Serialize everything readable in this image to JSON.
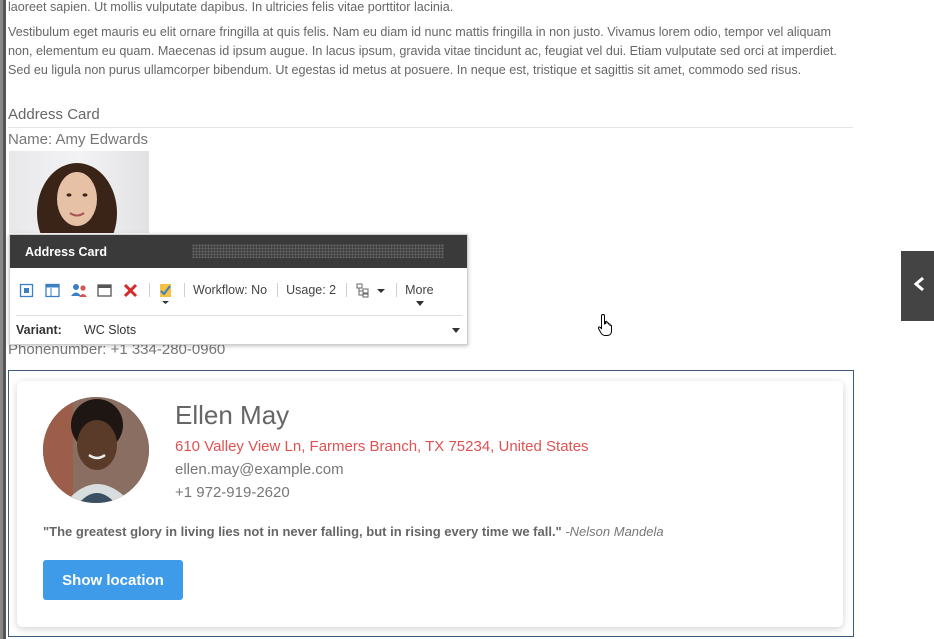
{
  "text": {
    "para1": "laoreet sapien. Ut mollis vulputate dapibus. In ultricies felis vitae porttitor lacinia.",
    "para2": "Vestibulum eget mauris eu elit ornare fringilla at quis felis. Nam eu diam id nunc mattis fringilla in non justo. Vivamus lorem odio, tempor vel aliquam non, elementum eu quam. Maecenas id ipsum augue. In lacus ipsum, gravida vitae tincidunt ac, feugiat vel dui. Etiam vulputate sed orci at imperdiet. Sed eu ligula non purus ullamcorper bibendum. Ut egestas id metus at posuere. In neque est, tristique et sagittis sit amet, commodo sed risus.",
    "heading": "Address Card",
    "name_line": "Name: Amy Edwards",
    "phone_line": "Phonenumber: +1 334-280-0960"
  },
  "toolbar": {
    "title": "Address Card",
    "workflow": "Workflow: No",
    "usage": "Usage: 2",
    "more": "More",
    "variant_label": "Variant:",
    "variant_value": "WC Slots",
    "icons": [
      "select-icon",
      "layout-icon",
      "personalize-icon",
      "window-icon",
      "delete-icon",
      "approve-icon",
      "tree-icon"
    ]
  },
  "card": {
    "name": "Ellen May",
    "address": "610 Valley View Ln, Farmers Branch, TX 75234, United States",
    "email": "ellen.may@example.com",
    "phone": "+1 972-919-2620",
    "quote": "\"The greatest glory in living lies not in never falling, but in rising every time we fall.\"",
    "quote_author": "-Nelson Mandela",
    "button": "Show location"
  },
  "colors": {
    "address_red": "#e05252",
    "button_blue": "#3d9be9",
    "toolbar_dark": "#3a3a3a"
  }
}
